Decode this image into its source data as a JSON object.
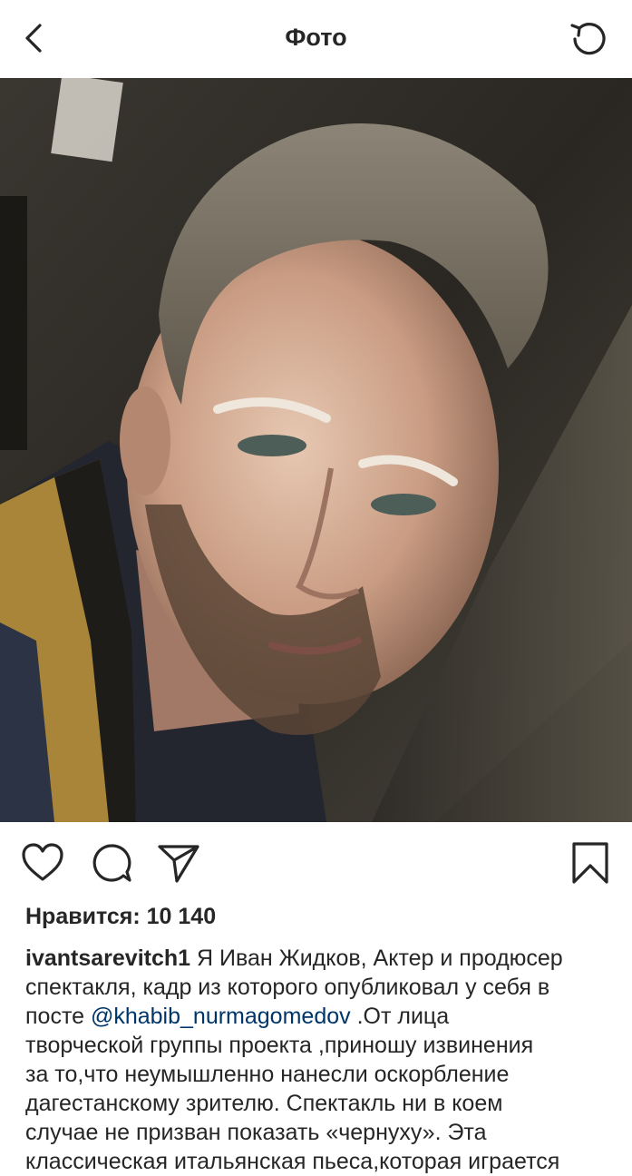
{
  "nav": {
    "title": "Фото",
    "back_icon": "chevron-left-icon",
    "refresh_icon": "refresh-icon"
  },
  "photo": {
    "subject": "selfie portrait"
  },
  "actions": {
    "like_icon": "heart-icon",
    "comment_icon": "comment-icon",
    "share_icon": "send-icon",
    "save_icon": "bookmark-icon"
  },
  "likes": {
    "text": "Нравится: 10 140"
  },
  "caption": {
    "username": "ivantsarevitch1",
    "line1_rest": " Я Иван Жидков, Актер и продюсер",
    "line2": "спектакля, кадр из которого опубликовал у себя в",
    "line3_pre": "посте ",
    "mention": "@khabib_nurmagomedov",
    "line3_post": " .От лица",
    "line4": "творческой группы проекта ,приношу извинения",
    "line5": "за то,что неумышленно нанесли оскорбление",
    "line6": "дагестанскому зрителю. Спектакль ни в коем",
    "line7": "случае не призван показать «чернуху». Эта",
    "line8": "классическая итальянская пьеса,которая играется"
  }
}
